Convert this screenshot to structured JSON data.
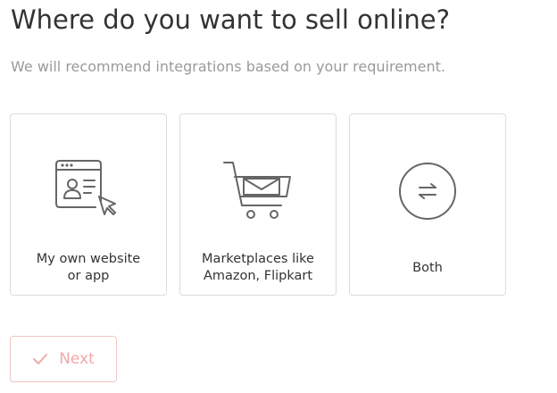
{
  "header": {
    "title": "Where do you want to sell online?",
    "subtitle": "We will recommend integrations based on your requirement."
  },
  "options": [
    {
      "icon": "website-browser-cursor-icon",
      "line1": "My own website",
      "line2": "or app"
    },
    {
      "icon": "shopping-cart-icon",
      "line1": "Marketplaces like",
      "line2": "Amazon, Flipkart"
    },
    {
      "icon": "exchange-arrows-icon",
      "line1": "Both",
      "line2": ""
    }
  ],
  "actions": {
    "next_label": "Next",
    "next_icon": "checkmark-icon"
  },
  "colors": {
    "icon_stroke": "#666666",
    "card_border": "#dcdcdc",
    "next_accent": "#f0a8a8",
    "subtitle_text": "#9a9a9a"
  }
}
